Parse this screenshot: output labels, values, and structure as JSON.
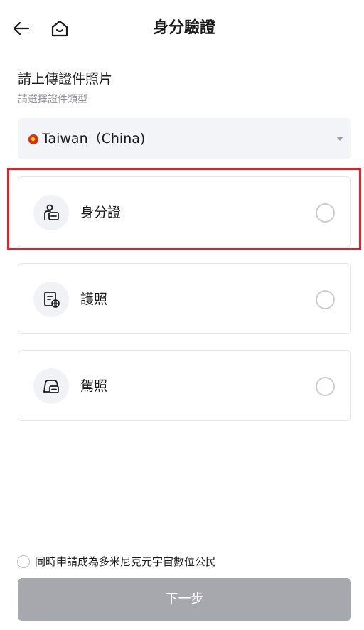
{
  "header": {
    "title": "身分驗證",
    "back_icon": "arrow-left-icon",
    "home_icon": "home-icon"
  },
  "upload": {
    "title": "請上傳證件照片",
    "subtitle": "請選擇證件類型"
  },
  "country_select": {
    "selected": "Taiwan（China)",
    "flag_icon": "flag-icon"
  },
  "options": [
    {
      "label": "身分證",
      "icon": "id-card-icon",
      "selected": false
    },
    {
      "label": "護照",
      "icon": "passport-icon",
      "selected": false
    },
    {
      "label": "駕照",
      "icon": "driver-license-icon",
      "selected": false
    }
  ],
  "citizen_option": {
    "label": "同時申請成為多米尼克元宇宙數位公民",
    "checked": false
  },
  "next_button": {
    "label": "下一步"
  },
  "colors": {
    "highlight": "#e0232a",
    "button_disabled": "#a7a8ad",
    "select_bg": "#f2f4f8"
  }
}
